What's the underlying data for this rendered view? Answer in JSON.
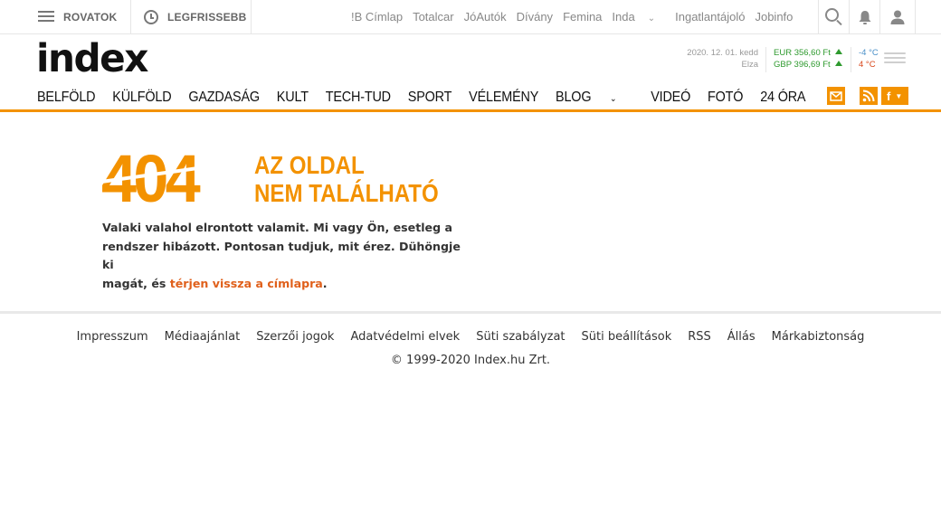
{
  "topbar": {
    "rovatok_label": "ROVATOK",
    "legfrissebb_label": "LEGFRISSEBB",
    "partners": [
      "!B Címlap",
      "Totalcar",
      "JóAutók",
      "Dívány",
      "Femina",
      "Inda",
      "Ingatlantájoló",
      "Jobinfo"
    ]
  },
  "logo": {
    "text": "index",
    "color": "#111111"
  },
  "info": {
    "date": "2020. 12. 01. kedd",
    "nameday": "Elza",
    "eur": "EUR 356,60 Ft",
    "gbp": "GBP 396,69 Ft",
    "temp_low": "-4 °C",
    "temp_high": "4 °C",
    "weather_icon": "fog-icon"
  },
  "nav": {
    "items": [
      "BELFÖLD",
      "KÜLFÖLD",
      "GAZDASÁG",
      "KULT",
      "TECH-TUD",
      "SPORT",
      "VÉLEMÉNY",
      "BLOG",
      "VIDEÓ",
      "FOTÓ",
      "24 ÓRA"
    ],
    "social": {
      "mail": "mail-icon",
      "rss": "rss-icon",
      "facebook": "f"
    }
  },
  "error": {
    "code": "404",
    "title_line1": "AZ OLDAL",
    "title_line2": "NEM TALÁLHATÓ",
    "message_line1": "Valaki valahol elrontott valamit. Mi vagy Ön, esetleg a",
    "message_line2": "rendszer hibázott. Pontosan tudjuk, mit érez. Dühöngje ki",
    "message_prefix": "magát, és ",
    "message_link": "térjen vissza a címlapra",
    "message_suffix": "."
  },
  "footer": {
    "links": [
      "Impresszum",
      "Médiaajánlat",
      "Szerzői jogok",
      "Adatvédelmi elvek",
      "Süti szabályzat",
      "Süti beállítások",
      "RSS",
      "Állás",
      "Márkabiztonság"
    ],
    "copyright": "© 1999-2020 Index.hu Zrt."
  },
  "colors": {
    "accent": "#f39200",
    "link": "#e0601b",
    "rate_up": "#2e9a2e"
  }
}
